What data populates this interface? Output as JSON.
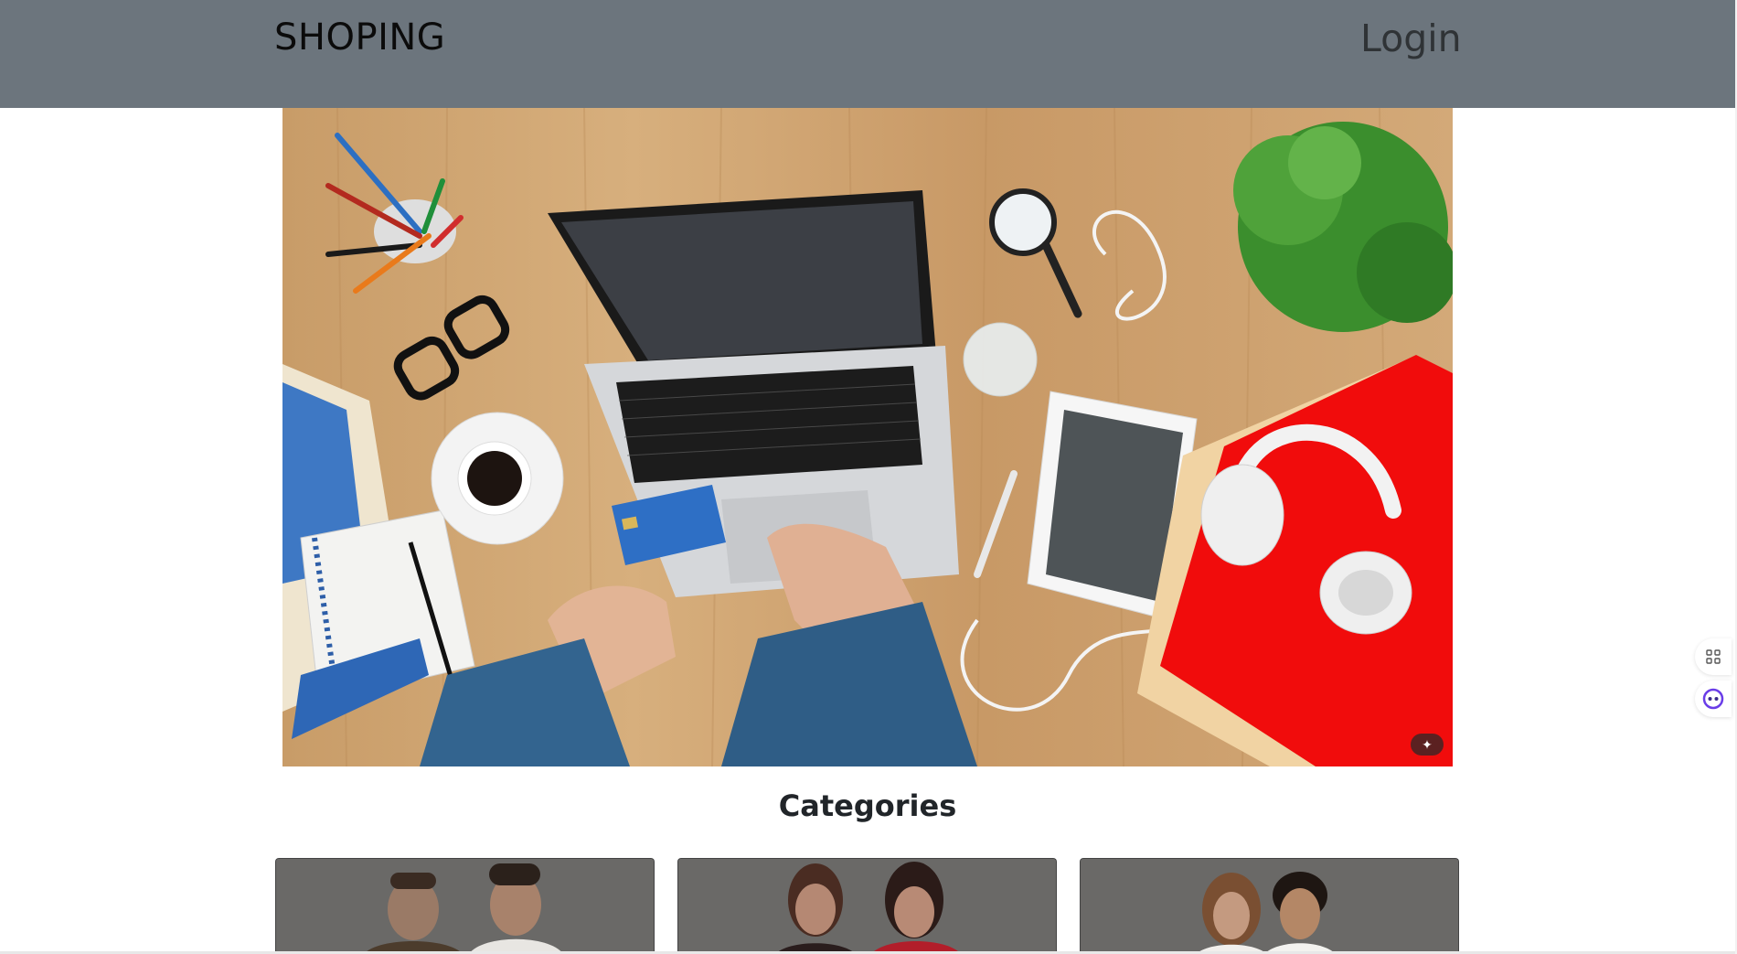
{
  "navbar": {
    "brand": "SHOPING",
    "login_label": "Login",
    "background": "#6c757d"
  },
  "hero": {
    "image": "workspace-laptop-credit-card",
    "badge_icon": "magic-wand-icon"
  },
  "categories": {
    "title": "Categories",
    "cards": [
      {
        "image": "men-models"
      },
      {
        "image": "women-models"
      },
      {
        "image": "kids-models"
      }
    ]
  },
  "side_tools": [
    {
      "icon": "apps-grid-icon"
    },
    {
      "icon": "assistant-icon"
    }
  ]
}
